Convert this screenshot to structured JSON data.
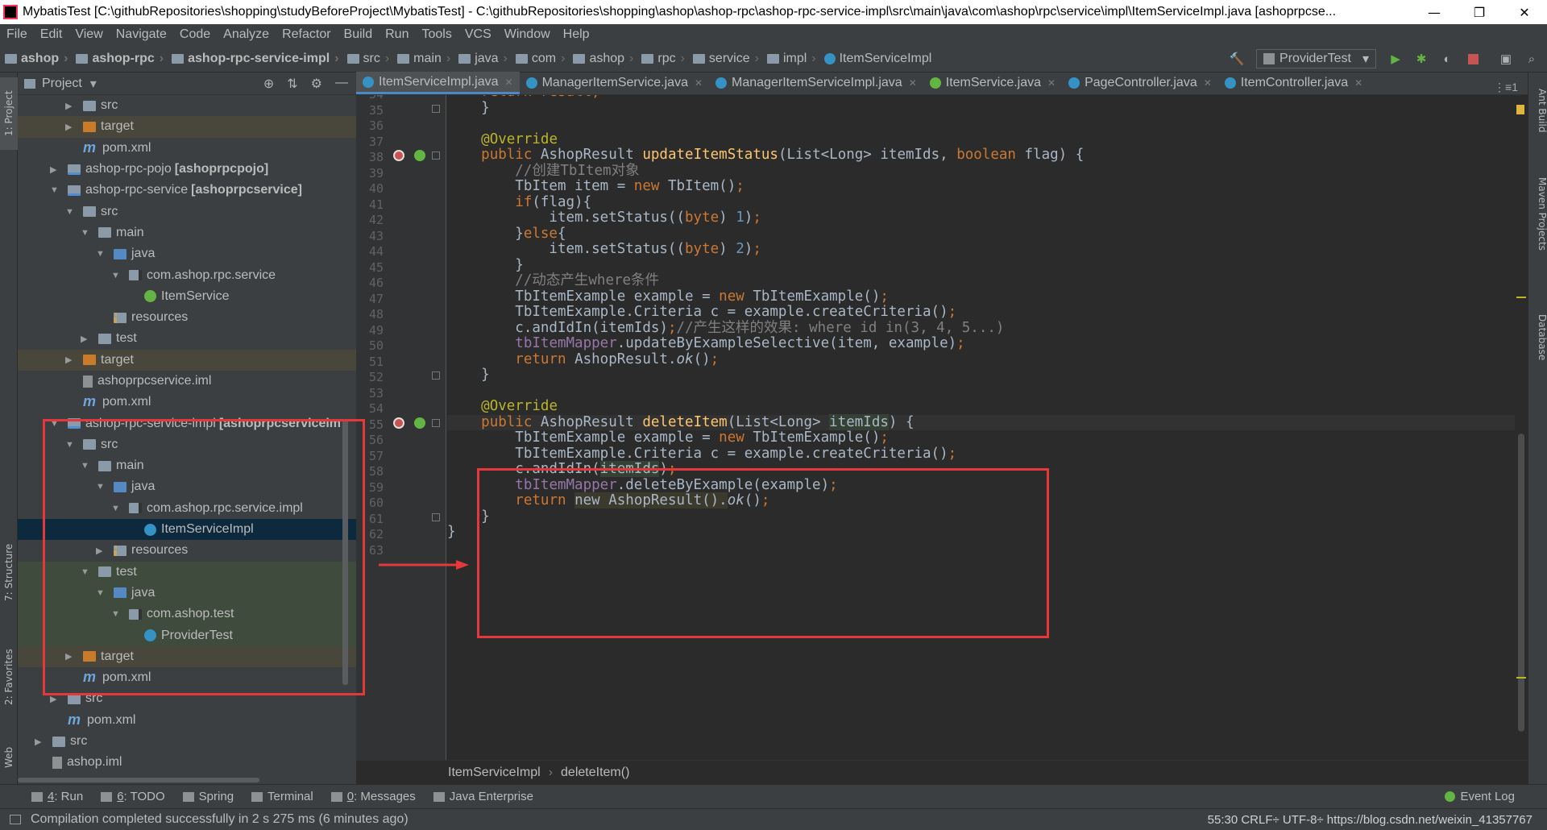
{
  "window": {
    "title": "MybatisTest [C:\\githubRepositories\\shopping\\studyBeforeProject\\MybatisTest] - C:\\githubRepositories\\shopping\\ashop\\ashop-rpc\\ashop-rpc-service-impl\\src\\main\\java\\com\\ashop\\rpc\\service\\impl\\ItemServiceImpl.java [ashoprpcse...",
    "minimize": "—",
    "restore": "❐",
    "close": "✕"
  },
  "menu": [
    "File",
    "Edit",
    "View",
    "Navigate",
    "Code",
    "Analyze",
    "Refactor",
    "Build",
    "Run",
    "Tools",
    "VCS",
    "Window",
    "Help"
  ],
  "nav": {
    "crumbs": [
      "ashop",
      "ashop-rpc",
      "ashop-rpc-service-impl",
      "src",
      "main",
      "java",
      "com",
      "ashop",
      "rpc",
      "service",
      "impl",
      "ItemServiceImpl"
    ],
    "run_config": "ProviderTest",
    "run_config_arrow": "▾"
  },
  "left_strip": {
    "project": "1: Project",
    "structure": "7: Structure",
    "favorites": "2: Favorites",
    "web": "Web"
  },
  "right_strip": {
    "ant": "Ant Build",
    "maven": "Maven Projects",
    "database": "Database"
  },
  "project_panel": {
    "title": "Project",
    "dropdown": "▾",
    "tree": [
      {
        "indent": 3,
        "arrow": "▶",
        "icon": "folder",
        "label": "src",
        "bold": ""
      },
      {
        "indent": 3,
        "arrow": "▶",
        "icon": "folder-orange",
        "label": "target",
        "bold": "",
        "row": "excluded"
      },
      {
        "indent": 3,
        "arrow": "",
        "icon": "maven",
        "label": "pom.xml",
        "bold": ""
      },
      {
        "indent": 2,
        "arrow": "▶",
        "icon": "module",
        "label": "ashop-rpc-pojo",
        "bold": "[ashoprpcpojo]"
      },
      {
        "indent": 2,
        "arrow": "▼",
        "icon": "module",
        "label": "ashop-rpc-service",
        "bold": "[ashoprpcservice]"
      },
      {
        "indent": 3,
        "arrow": "▼",
        "icon": "folder",
        "label": "src",
        "bold": ""
      },
      {
        "indent": 4,
        "arrow": "▼",
        "icon": "folder",
        "label": "main",
        "bold": ""
      },
      {
        "indent": 5,
        "arrow": "▼",
        "icon": "src",
        "label": "java",
        "bold": ""
      },
      {
        "indent": 6,
        "arrow": "▼",
        "icon": "pkg",
        "label": "com.ashop.rpc.service",
        "bold": ""
      },
      {
        "indent": 7,
        "arrow": "",
        "icon": "iface",
        "label": "ItemService",
        "bold": ""
      },
      {
        "indent": 5,
        "arrow": "",
        "icon": "res",
        "label": "resources",
        "bold": ""
      },
      {
        "indent": 4,
        "arrow": "▶",
        "icon": "folder",
        "label": "test",
        "bold": ""
      },
      {
        "indent": 3,
        "arrow": "▶",
        "icon": "folder-orange",
        "label": "target",
        "bold": "",
        "row": "excluded"
      },
      {
        "indent": 3,
        "arrow": "",
        "icon": "iml",
        "label": "ashoprpcservice.iml",
        "bold": ""
      },
      {
        "indent": 3,
        "arrow": "",
        "icon": "maven",
        "label": "pom.xml",
        "bold": ""
      },
      {
        "indent": 2,
        "arrow": "▼",
        "icon": "module",
        "label": "ashop-rpc-service-impl",
        "bold": "[ashoprpcserviceim"
      },
      {
        "indent": 3,
        "arrow": "▼",
        "icon": "folder",
        "label": "src",
        "bold": ""
      },
      {
        "indent": 4,
        "arrow": "▼",
        "icon": "folder",
        "label": "main",
        "bold": ""
      },
      {
        "indent": 5,
        "arrow": "▼",
        "icon": "src",
        "label": "java",
        "bold": ""
      },
      {
        "indent": 6,
        "arrow": "▼",
        "icon": "pkg",
        "label": "com.ashop.rpc.service.impl",
        "bold": ""
      },
      {
        "indent": 7,
        "arrow": "",
        "icon": "cls",
        "label": "ItemServiceImpl",
        "bold": "",
        "row": "selected"
      },
      {
        "indent": 5,
        "arrow": "▶",
        "icon": "res",
        "label": "resources",
        "bold": ""
      },
      {
        "indent": 4,
        "arrow": "▼",
        "icon": "folder",
        "label": "test",
        "bold": "",
        "row": "test"
      },
      {
        "indent": 5,
        "arrow": "▼",
        "icon": "src",
        "label": "java",
        "bold": "",
        "row": "test"
      },
      {
        "indent": 6,
        "arrow": "▼",
        "icon": "pkg",
        "label": "com.ashop.test",
        "bold": "",
        "row": "test"
      },
      {
        "indent": 7,
        "arrow": "",
        "icon": "cls",
        "label": "ProviderTest",
        "bold": "",
        "row": "test"
      },
      {
        "indent": 3,
        "arrow": "▶",
        "icon": "folder-orange",
        "label": "target",
        "bold": "",
        "row": "excluded"
      },
      {
        "indent": 3,
        "arrow": "",
        "icon": "maven",
        "label": "pom.xml",
        "bold": ""
      },
      {
        "indent": 2,
        "arrow": "▶",
        "icon": "folder",
        "label": "src",
        "bold": ""
      },
      {
        "indent": 2,
        "arrow": "",
        "icon": "maven",
        "label": "pom.xml",
        "bold": ""
      },
      {
        "indent": 1,
        "arrow": "▶",
        "icon": "folder",
        "label": "src",
        "bold": ""
      },
      {
        "indent": 1,
        "arrow": "",
        "icon": "iml",
        "label": "ashop.iml",
        "bold": ""
      }
    ]
  },
  "tabs": [
    {
      "label": "ItemServiceImpl.java",
      "kind": "class",
      "active": true
    },
    {
      "label": "ManagerItemService.java",
      "kind": "class",
      "active": false
    },
    {
      "label": "ManagerItemServiceImpl.java",
      "kind": "class",
      "active": false
    },
    {
      "label": "ItemService.java",
      "kind": "interface",
      "active": false
    },
    {
      "label": "PageController.java",
      "kind": "class",
      "active": false
    },
    {
      "label": "ItemController.java",
      "kind": "class",
      "active": false
    }
  ],
  "tab_close": "✕",
  "tab_menu": "⋮≡1",
  "code": {
    "first_line": 34,
    "lines": [
      [
        [
          "    ",
          ""
        ],
        [
          "return result;",
          "kw"
        ]
      ],
      [
        [
          "    }",
          ""
        ]
      ],
      [
        [
          "",
          ""
        ]
      ],
      [
        [
          "    ",
          ""
        ],
        [
          "@Override",
          "ann"
        ]
      ],
      [
        [
          "    ",
          ""
        ],
        [
          "public ",
          "kw"
        ],
        [
          "AshopResult ",
          ""
        ],
        [
          "updateItemStatus",
          "fn"
        ],
        [
          "(List<Long> itemIds, ",
          ""
        ],
        [
          "boolean ",
          "kw"
        ],
        [
          "flag) {",
          ""
        ]
      ],
      [
        [
          "        ",
          ""
        ],
        [
          "//创建TbItem对象",
          "cm"
        ]
      ],
      [
        [
          "        TbItem item = ",
          ""
        ],
        [
          "new ",
          "kw"
        ],
        [
          "TbItem()",
          ""
        ],
        [
          ";",
          "kw"
        ]
      ],
      [
        [
          "        ",
          ""
        ],
        [
          "if",
          "kw"
        ],
        [
          "(flag){",
          ""
        ]
      ],
      [
        [
          "            item.setStatus((",
          ""
        ],
        [
          "byte",
          "kw"
        ],
        [
          ") ",
          ""
        ],
        [
          "1",
          "num"
        ],
        [
          ")",
          ""
        ],
        [
          ";",
          "kw"
        ]
      ],
      [
        [
          "        }",
          ""
        ],
        [
          "else",
          "kw"
        ],
        [
          "{",
          ""
        ]
      ],
      [
        [
          "            item.setStatus((",
          ""
        ],
        [
          "byte",
          "kw"
        ],
        [
          ") ",
          ""
        ],
        [
          "2",
          "num"
        ],
        [
          ")",
          ""
        ],
        [
          ";",
          "kw"
        ]
      ],
      [
        [
          "        }",
          ""
        ]
      ],
      [
        [
          "        ",
          ""
        ],
        [
          "//动态产生where条件",
          "cm"
        ]
      ],
      [
        [
          "        TbItemExample example = ",
          ""
        ],
        [
          "new ",
          "kw"
        ],
        [
          "TbItemExample()",
          ""
        ],
        [
          ";",
          "kw"
        ]
      ],
      [
        [
          "        TbItemExample.Criteria c = example.createCriteria()",
          ""
        ],
        [
          ";",
          "kw"
        ]
      ],
      [
        [
          "        c.andIdIn(itemIds)",
          ""
        ],
        [
          ";",
          "kw"
        ],
        [
          "//产生这样的效果: where id in(3, 4, 5...)",
          "cm"
        ]
      ],
      [
        [
          "        ",
          ""
        ],
        [
          "tbItemMapper",
          "fld"
        ],
        [
          ".updateByExampleSelective(item, example)",
          ""
        ],
        [
          ";",
          "kw"
        ]
      ],
      [
        [
          "        ",
          ""
        ],
        [
          "return ",
          "kw"
        ],
        [
          "AshopResult.",
          ""
        ],
        [
          "ok",
          "it"
        ],
        [
          "()",
          ""
        ],
        [
          ";",
          "kw"
        ]
      ],
      [
        [
          "    }",
          ""
        ]
      ],
      [
        [
          "",
          ""
        ]
      ],
      [
        [
          "    ",
          ""
        ],
        [
          "@Override",
          "ann"
        ]
      ],
      [
        [
          "    ",
          ""
        ],
        [
          "public ",
          "kw"
        ],
        [
          "AshopResult ",
          ""
        ],
        [
          "deleteItem",
          "fn"
        ],
        [
          "(List<Long> ",
          ""
        ],
        [
          "itemIds",
          "hl"
        ],
        [
          ") {",
          ""
        ]
      ],
      [
        [
          "        TbItemExample example = ",
          ""
        ],
        [
          "new ",
          "kw"
        ],
        [
          "TbItemExample()",
          ""
        ],
        [
          ";",
          "kw"
        ]
      ],
      [
        [
          "        TbItemExample.Criteria c = example.createCriteria()",
          ""
        ],
        [
          ";",
          "kw"
        ]
      ],
      [
        [
          "        c.andIdIn(",
          ""
        ],
        [
          "itemIds",
          "hl"
        ],
        [
          ")",
          ""
        ],
        [
          ";",
          "kw"
        ]
      ],
      [
        [
          "        ",
          ""
        ],
        [
          "tbItemMapper",
          "fld"
        ],
        [
          ".deleteByExample(example)",
          ""
        ],
        [
          ";",
          "kw"
        ]
      ],
      [
        [
          "        ",
          ""
        ],
        [
          "return ",
          "kw"
        ],
        [
          "new AshopResult().",
          "hl2"
        ],
        [
          "ok",
          "it"
        ],
        [
          "()",
          ""
        ],
        [
          ";",
          "kw"
        ]
      ],
      [
        [
          "    }",
          ""
        ]
      ],
      [
        [
          "}",
          ""
        ]
      ],
      [
        [
          "",
          ""
        ]
      ]
    ]
  },
  "editor_breadcrumb": [
    "ItemServiceImpl",
    "deleteItem()"
  ],
  "bottom_tools": [
    {
      "key": "4",
      "label": ": Run",
      "icon": "run-icon"
    },
    {
      "key": "6",
      "label": ": TODO",
      "icon": "todo-icon"
    },
    {
      "key": "",
      "label": "Spring",
      "icon": "spring-icon"
    },
    {
      "key": "",
      "label": "Terminal",
      "icon": "terminal-icon"
    },
    {
      "key": "0",
      "label": ": Messages",
      "icon": "messages-icon"
    },
    {
      "key": "",
      "label": "Java Enterprise",
      "icon": "java-enterprise-icon"
    }
  ],
  "event_log": "Event Log",
  "status": {
    "message": "Compilation completed successfully in 2 s 275 ms (6 minutes ago)",
    "right": "55:30   CRLF÷   UTF-8÷   https://blog.csdn.net/weixin_41357767"
  }
}
